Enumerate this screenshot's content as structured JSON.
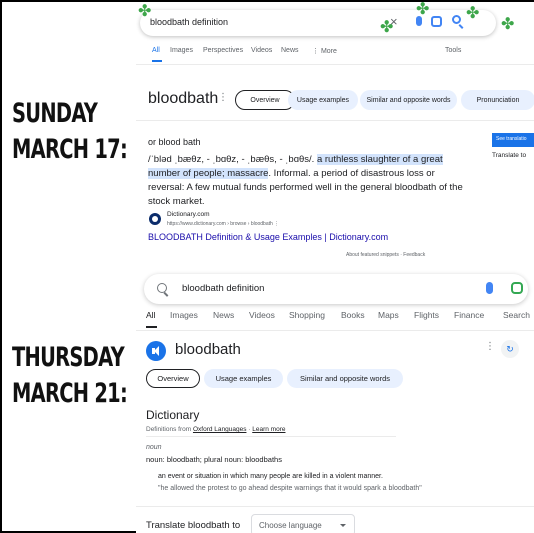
{
  "labels": {
    "first": [
      "SUNDAY",
      "MARCH 17:"
    ],
    "second": [
      "THURSDAY",
      "MARCH 21:"
    ]
  },
  "decor": {
    "clover_color": "#3da64a",
    "clover_icon": "shamrock-icon",
    "clover_glyph": "✤"
  },
  "shot1": {
    "query": "bloodbath definition",
    "tabs": [
      "All",
      "Images",
      "Perspectives",
      "Videos",
      "News",
      "⋮ More",
      "Tools"
    ],
    "word": "bloodbath",
    "chips": [
      "Overview",
      "Usage examples",
      "Similar and opposite words",
      "Pronunciation"
    ],
    "or_text": "or blood bath",
    "pron": "/ˈbləd ˌbæθz, - ˌbɑθz, - ˌbæθs, - ˌbɑθs/.",
    "def_hl": "a ruthless slaughter of a great number of people; massacre",
    "def_rest": ". Informal. a period of disastrous loss or reversal: A few mutual funds performed well in the general bloodbath of the stock market.",
    "site_name": "Dictionary.com",
    "site_url": "https://www.dictionary.com › browse › bloodbath  ⋮",
    "link": "BLOODBATH Definition & Usage Examples | Dictionary.com",
    "about": "About featured snippets  ·  Feedback",
    "side_button": "See translatio",
    "side_text": "Translate to"
  },
  "shot2": {
    "query": "bloodbath definition",
    "tabs": [
      "All",
      "Images",
      "News",
      "Videos",
      "Shopping",
      "Books",
      "Maps",
      "Flights",
      "Finance",
      "Search"
    ],
    "word": "bloodbath",
    "chips": [
      "Overview",
      "Usage examples",
      "Similar and opposite words"
    ],
    "dictionary": "Dictionary",
    "source_prefix": "Definitions from ",
    "source_link": "Oxford Languages",
    "learn_more": "Learn more",
    "pos": "noun",
    "noun_line": "noun: bloodbath; plural noun: bloodbaths",
    "sense": "an event or situation in which many people are killed in a violent manner.",
    "example": "\"he allowed the protest to go ahead despite warnings that it would spark a bloodbath\"",
    "translate_label": "Translate bloodbath to",
    "choose_language": "Choose language"
  }
}
